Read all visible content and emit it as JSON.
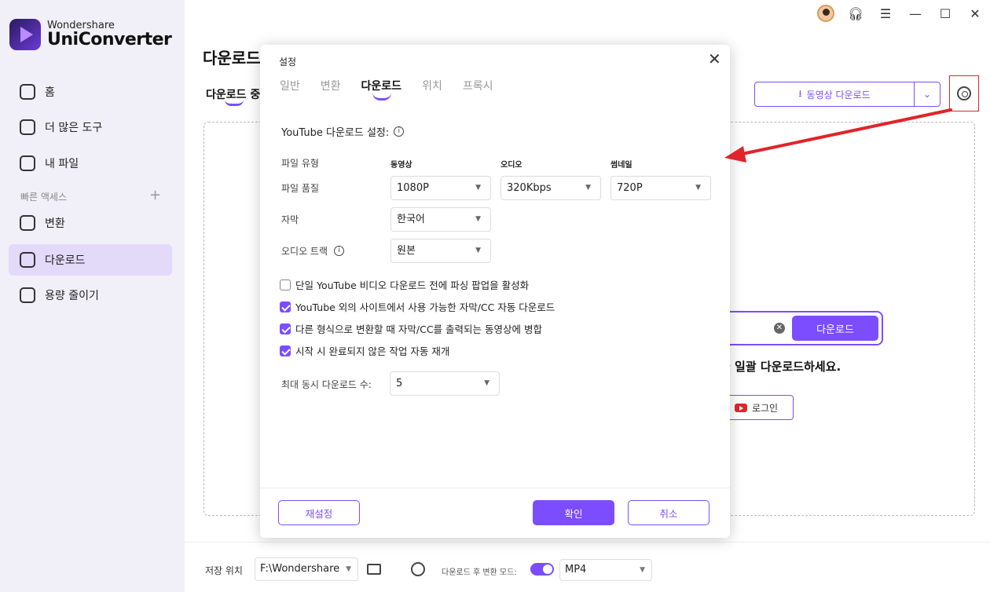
{
  "app": {
    "brand_top": "Wondershare",
    "brand_bottom": "UniConverter"
  },
  "sidebar": {
    "items": [
      {
        "label": "홈",
        "icon": "home-icon"
      },
      {
        "label": "더 많은 도구",
        "icon": "toolbox-icon"
      },
      {
        "label": "내 파일",
        "icon": "file-icon"
      }
    ],
    "quick_access_label": "빠른 액세스",
    "quick_items": [
      {
        "label": "변환",
        "icon": "convert-icon"
      },
      {
        "label": "다운로드",
        "icon": "download-icon",
        "active": true
      },
      {
        "label": "용량 줄이기",
        "icon": "compress-icon"
      }
    ]
  },
  "main": {
    "title": "다운로드",
    "tab_label": "다운로드 중",
    "download_video_label": "동영상 다운로드",
    "url_download_label": "다운로드",
    "batch_text": "을 일괄 다운로드하세요.",
    "login_label": "로그인"
  },
  "footer": {
    "save_location_label": "저장 위치",
    "save_path": "F:\\Wondershare",
    "post_convert_mode_label": "다운로드 후 변환 모드:",
    "format": "MP4"
  },
  "dialog": {
    "title": "설정",
    "tabs": [
      "일반",
      "변환",
      "다운로드",
      "위치",
      "프록시"
    ],
    "active_tab": 2,
    "youtube_settings_label": "YouTube 다운로드 설정:",
    "file_type_label": "파일 유형",
    "columns": [
      "동영상",
      "오디오",
      "썸네일"
    ],
    "quality_label": "파일 품질",
    "video_quality": "1080P",
    "audio_quality": "320Kbps",
    "thumbnail_quality": "720P",
    "subtitle_label": "자막",
    "subtitle_value": "한국어",
    "audio_track_label": "오디오 트랙",
    "audio_track_value": "원본",
    "checkboxes": [
      {
        "label": "단일 YouTube 비디오 다운로드 전에 파싱 팝업을 활성화",
        "checked": false
      },
      {
        "label": "YouTube 외의 사이트에서 사용 가능한 자막/CC 자동 다운로드",
        "checked": true
      },
      {
        "label": "다른 형식으로 변환할 때 자막/CC를 출력되는 동영상에 병합",
        "checked": true
      },
      {
        "label": "시작 시 완료되지 않은 작업 자동 재개",
        "checked": true
      }
    ],
    "max_concurrent_label": "최대 동시 다운로드 수:",
    "max_concurrent_value": "5",
    "reset_label": "재설정",
    "ok_label": "확인",
    "cancel_label": "취소"
  },
  "colors": {
    "accent": "#7b4dff",
    "annotation_red": "#e0242a",
    "sidebar_bg": "#f1eff8"
  }
}
